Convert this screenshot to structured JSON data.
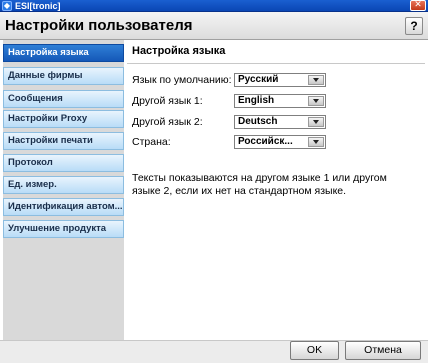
{
  "window": {
    "app_title": "ESI[tronic]",
    "app_icon": "esitronic-app-icon",
    "close_icon": "close-icon",
    "close_glyph": "✕"
  },
  "dialog": {
    "title": "Настройки пользователя",
    "help_label": "?"
  },
  "sidebar": {
    "items": [
      {
        "label": "Настройка языка",
        "active": true
      },
      {
        "label": "Данные фирмы",
        "active": false
      },
      {
        "label": "Сообщения",
        "active": false
      },
      {
        "label": "Настройки Proxy",
        "active": false
      },
      {
        "label": "Настройки печати",
        "active": false
      },
      {
        "label": "Протокол",
        "active": false
      },
      {
        "label": "Ед. измер.",
        "active": false
      },
      {
        "label": "Идентификация автом...",
        "active": false
      },
      {
        "label": "Улучшение продукта",
        "active": false
      }
    ]
  },
  "main": {
    "section_title": "Настройка языка",
    "fields": [
      {
        "label": "Язык по умолчанию:",
        "value": "Русский"
      },
      {
        "label": "Другой язык 1:",
        "value": "English"
      },
      {
        "label": "Другой язык 2:",
        "value": "Deutsch"
      },
      {
        "label": "Страна:",
        "value": "Российск..."
      }
    ],
    "info_text": "Тексты показываются на другом языке 1 или другом языке 2, если их нет на стандартном языке."
  },
  "footer": {
    "ok_label": "OK",
    "cancel_label": "Отмена"
  },
  "colors": {
    "title_bar": "#0a46b4",
    "active_item": "#1f68c8",
    "item": "#c9e4f9"
  }
}
